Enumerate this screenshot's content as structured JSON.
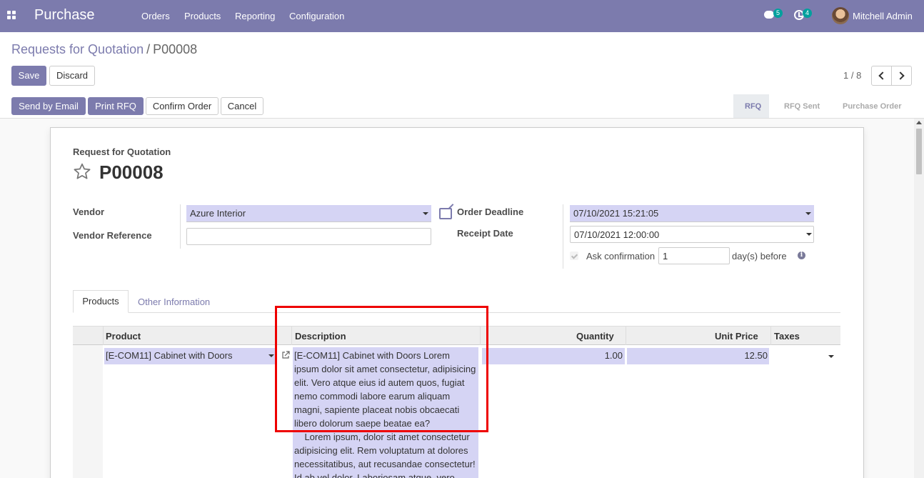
{
  "navbar": {
    "app_name": "Purchase",
    "menu": [
      "Orders",
      "Products",
      "Reporting",
      "Configuration"
    ],
    "messages_count": "5",
    "activities_count": "4",
    "user_name": "Mitchell Admin"
  },
  "breadcrumb": {
    "parent": "Requests for Quotation",
    "separator": "/",
    "current": "P00008"
  },
  "buttons": {
    "save": "Save",
    "discard": "Discard",
    "send_email": "Send by Email",
    "print_rfq": "Print RFQ",
    "confirm_order": "Confirm Order",
    "cancel": "Cancel"
  },
  "pager": {
    "value": "1 / 8"
  },
  "statusbar": {
    "stages": [
      "RFQ",
      "RFQ Sent",
      "Purchase Order"
    ],
    "active": "RFQ"
  },
  "form": {
    "subtitle": "Request for Quotation",
    "name": "P00008",
    "vendor_label": "Vendor",
    "vendor_value": "Azure Interior",
    "vendor_ref_label": "Vendor Reference",
    "vendor_ref_value": "",
    "order_deadline_label": "Order Deadline",
    "order_deadline_value": "07/10/2021 15:21:05",
    "receipt_date_label": "Receipt Date",
    "receipt_date_value": "07/10/2021 12:00:00",
    "ask_confirmation_label": "Ask confirmation",
    "ask_confirmation_days": "1",
    "days_before_label": "day(s) before",
    "info_icon": "i"
  },
  "tabs": {
    "products": "Products",
    "other_info": "Other Information"
  },
  "table": {
    "columns": {
      "product": "Product",
      "description": "Description",
      "quantity": "Quantity",
      "unit_price": "Unit Price",
      "taxes": "Taxes"
    },
    "rows": [
      {
        "product": "[E-COM11] Cabinet with Doors",
        "description": "[E-COM11] Cabinet with Doors Lorem ipsum dolor sit amet consectetur, adipisicing elit. Vero atque eius id autem quos, fugiat nemo commodi labore earum aliquam magni, sapiente placeat nobis obcaecati libero dolorum saepe beatae ea?\n    Lorem ipsum, dolor sit amet consectetur adipisicing elit. Rem voluptatum at dolores necessitatibus, aut recusandae consectetur! Id ab vel dolor. Laboriosam atque, vero",
        "quantity": "1.00",
        "unit_price": "12.50",
        "taxes": ""
      }
    ]
  },
  "colors": {
    "brand": "#7c7bad",
    "field_bg": "#d5d4f4",
    "highlight": "#e00000"
  }
}
